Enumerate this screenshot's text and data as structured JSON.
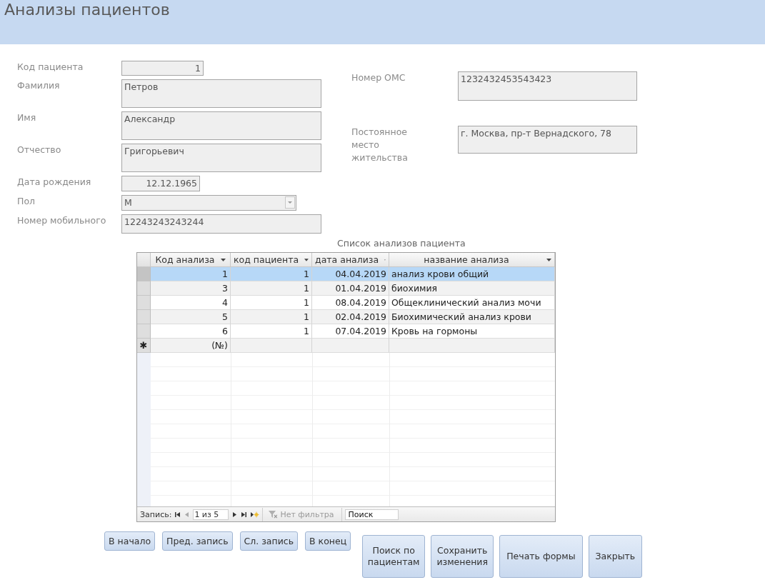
{
  "window": {
    "title": "Анализы пациентов"
  },
  "fields_left": [
    {
      "label": "Код пациента",
      "value": "1",
      "kind": "number"
    },
    {
      "label": "Фамилия",
      "value": "Петров",
      "kind": "memo"
    },
    {
      "label": "Имя",
      "value": "Александр",
      "kind": "memo"
    },
    {
      "label": "Отчество",
      "value": "Григорьевич",
      "kind": "memo"
    },
    {
      "label": "Дата рождения",
      "value": "12.12.1965",
      "kind": "date"
    },
    {
      "label": "Пол",
      "value": "М",
      "kind": "combo"
    },
    {
      "label": "Номер мобильного",
      "value": "12243243243244",
      "kind": "text"
    }
  ],
  "fields_right": [
    {
      "label": "Номер ОМС",
      "value": "1232432453543423",
      "kind": "memo"
    },
    {
      "label": "Постоянное место жительства",
      "value": "г. Москва, пр-т Вернадского, 78",
      "kind": "memo"
    }
  ],
  "subform": {
    "caption": "Список анализов пациента",
    "columns": [
      "Код анализа",
      "код пациента",
      "дата анализа",
      "название анализа"
    ],
    "rows": [
      {
        "cells": [
          "1",
          "1",
          "04.04.2019",
          "анализ крови общий"
        ],
        "selected": true
      },
      {
        "cells": [
          "3",
          "1",
          "01.04.2019",
          "биохимия"
        ],
        "selected": false
      },
      {
        "cells": [
          "4",
          "1",
          "08.04.2019",
          "Общеклинический анализ мочи"
        ],
        "selected": false
      },
      {
        "cells": [
          "5",
          "1",
          "02.04.2019",
          "Биохимический анализ крови"
        ],
        "selected": false
      },
      {
        "cells": [
          "6",
          "1",
          "07.04.2019",
          "Кровь на гормоны"
        ],
        "selected": false
      }
    ],
    "new_row": {
      "marker": "✱",
      "placeholder": "(№)"
    },
    "navigation": {
      "label": "Запись:",
      "position": "1 из 5",
      "filter": "Нет фильтра",
      "search": "Поиск"
    }
  },
  "buttons": [
    {
      "label": "В начало",
      "kind": "small"
    },
    {
      "label": "Пред. запись",
      "kind": "small"
    },
    {
      "label": "Сл. запись",
      "kind": "small"
    },
    {
      "label": "В конец",
      "kind": "small"
    },
    {
      "label": "Поиск по пациентам",
      "kind": "large"
    },
    {
      "label": "Сохранить изменения",
      "kind": "large"
    },
    {
      "label": "Печать формы",
      "kind": "large"
    },
    {
      "label": "Закрыть",
      "kind": "large"
    }
  ]
}
